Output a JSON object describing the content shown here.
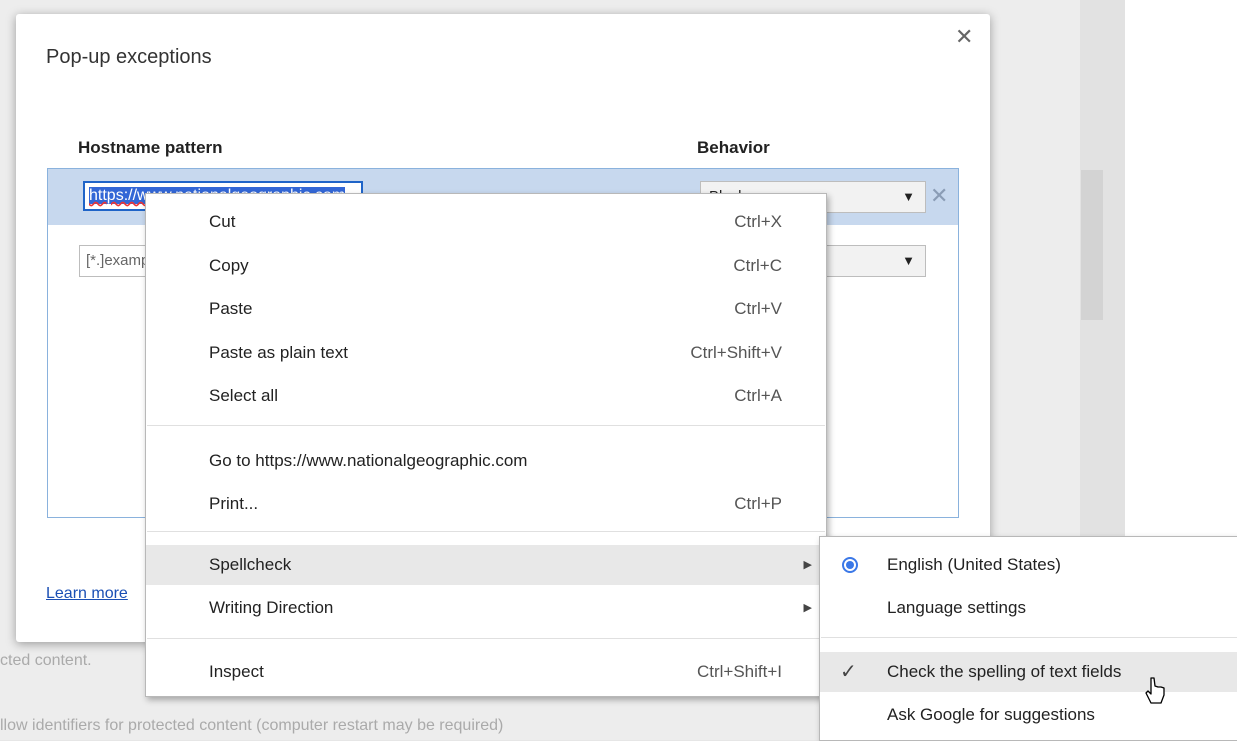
{
  "background": {
    "text_1": "cted content.",
    "text_2": "llow identifiers for protected content (computer restart may be required)"
  },
  "dialog": {
    "title": "Pop-up exceptions",
    "close_icon": "close-icon",
    "col_hostname": "Hostname pattern",
    "col_behavior": "Behavior",
    "rows": [
      {
        "hostname": "https://www.nationalgeographic.com",
        "behavior": "Block"
      },
      {
        "hostname_placeholder": "[*.]example.com",
        "behavior": ""
      }
    ],
    "learn_more": "Learn more"
  },
  "context_menu": {
    "items": [
      {
        "label": "Cut",
        "shortcut": "Ctrl+X"
      },
      {
        "label": "Copy",
        "shortcut": "Ctrl+C"
      },
      {
        "label": "Paste",
        "shortcut": "Ctrl+V"
      },
      {
        "label": "Paste as plain text",
        "shortcut": "Ctrl+Shift+V"
      },
      {
        "label": "Select all",
        "shortcut": "Ctrl+A"
      },
      {
        "label": "Go to https://www.nationalgeographic.com"
      },
      {
        "label": "Print...",
        "shortcut": "Ctrl+P"
      },
      {
        "label": "Spellcheck",
        "submenu": true
      },
      {
        "label": "Writing Direction",
        "submenu": true
      },
      {
        "label": "Inspect",
        "shortcut": "Ctrl+Shift+I"
      }
    ]
  },
  "spellcheck_submenu": {
    "items": [
      {
        "label": "English (United States)",
        "selected": true
      },
      {
        "label": "Language settings"
      },
      {
        "label": "Check the spelling of text fields",
        "checked": true
      },
      {
        "label": "Ask Google for suggestions"
      }
    ]
  },
  "colors": {
    "selection": "#3367d6",
    "row_highlight": "#c7d8ee",
    "link": "#1a4fb4",
    "radio": "#3b78e7"
  }
}
